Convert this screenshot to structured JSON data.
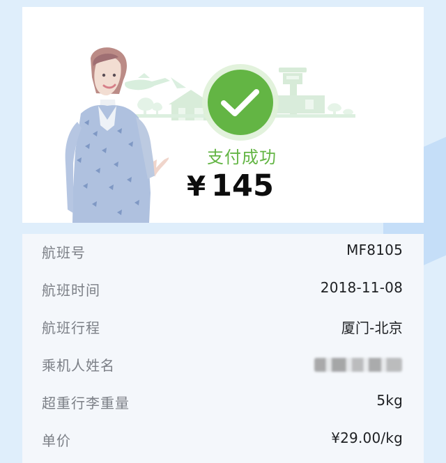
{
  "payment": {
    "status": "支付成功",
    "currency_symbol": "¥",
    "amount": "145"
  },
  "details": [
    {
      "label": "航班号",
      "value": "MF8105"
    },
    {
      "label": "航班时间",
      "value": "2018-11-08"
    },
    {
      "label": "航班行程",
      "value": "厦门-北京"
    },
    {
      "label": "乘机人姓名",
      "value": ""
    },
    {
      "label": "超重行李重量",
      "value": "5kg"
    },
    {
      "label": "单价",
      "value": "¥29.00/kg"
    }
  ],
  "colors": {
    "success": "#63b544",
    "background": "#dfeefb",
    "card_bottom": "#f4f7fb"
  },
  "icons": {
    "success": "check-circle-icon",
    "illustration": "flight-attendant-illustration",
    "scene": "airport-tower-illustration"
  }
}
